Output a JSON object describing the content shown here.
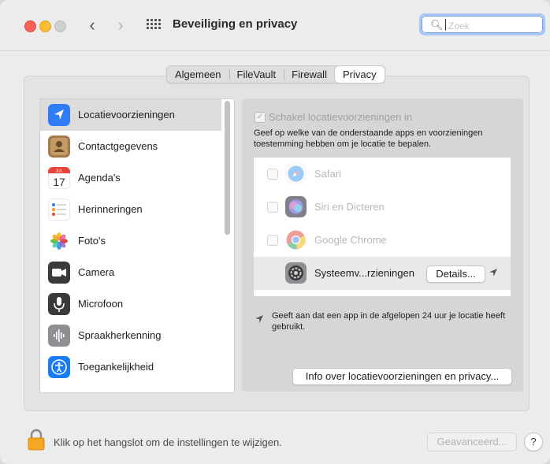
{
  "window": {
    "title": "Beveiliging en privacy"
  },
  "search": {
    "placeholder": "Zoek",
    "value": ""
  },
  "tabs": [
    {
      "label": "Algemeen",
      "active": false
    },
    {
      "label": "FileVault",
      "active": false
    },
    {
      "label": "Firewall",
      "active": false
    },
    {
      "label": "Privacy",
      "active": true
    }
  ],
  "sidebar": {
    "items": [
      {
        "label": "Locatievoorzieningen",
        "icon": "location-arrow-icon",
        "selected": true
      },
      {
        "label": "Contactgegevens",
        "icon": "contacts-icon"
      },
      {
        "label": "Agenda's",
        "icon": "calendar-icon",
        "month": "JUL",
        "day": "17"
      },
      {
        "label": "Herinneringen",
        "icon": "reminders-icon"
      },
      {
        "label": "Foto's",
        "icon": "photos-icon"
      },
      {
        "label": "Camera",
        "icon": "camera-icon"
      },
      {
        "label": "Microfoon",
        "icon": "microphone-icon"
      },
      {
        "label": "Spraakherkenning",
        "icon": "speech-recognition-icon"
      },
      {
        "label": "Toegankelijkheid",
        "icon": "accessibility-icon"
      }
    ]
  },
  "location": {
    "enable_label": "Schakel locatievoorzieningen in",
    "description": "Geef op welke van de onderstaande apps en voorzieningen toestemming hebben om je locatie te bepalen.",
    "apps": [
      {
        "label": "Safari",
        "icon": "safari-icon",
        "enabled": false
      },
      {
        "label": "Siri en Dicteren",
        "icon": "siri-icon",
        "enabled": false
      },
      {
        "label": "Google Chrome",
        "icon": "chrome-icon",
        "enabled": false
      },
      {
        "label": "Systeemv...rzieningen",
        "icon": "system-services-icon",
        "details_label": "Details..."
      }
    ],
    "note": "Geeft aan dat een app in de afgelopen 24 uur je locatie heeft gebruikt.",
    "info_button": "Info over locatievoorzieningen en privacy..."
  },
  "footer": {
    "lock_text": "Klik op het hangslot om de instellingen te wijzigen.",
    "advanced_label": "Geavanceerd...",
    "help_label": "?"
  }
}
